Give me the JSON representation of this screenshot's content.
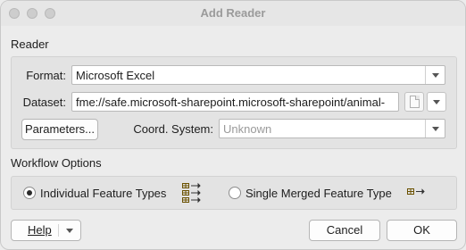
{
  "window": {
    "title": "Add Reader"
  },
  "reader": {
    "section_label": "Reader",
    "format_label": "Format:",
    "format_value": "Microsoft Excel",
    "dataset_label": "Dataset:",
    "dataset_value": "fme://safe.microsoft-sharepoint.microsoft-sharepoint/animal-",
    "parameters_button": "Parameters...",
    "coord_label": "Coord. System:",
    "coord_value": "Unknown"
  },
  "workflow": {
    "section_label": "Workflow Options",
    "individual_label": "Individual Feature Types",
    "individual_checked": true,
    "merged_label": "Single Merged Feature Type",
    "merged_checked": false,
    "individual_icon": "multiple-feature-types-icon",
    "merged_icon": "single-feature-type-icon",
    "icon_color": "#8a6a00"
  },
  "footer": {
    "help_button": "Help",
    "cancel_button": "Cancel",
    "ok_button": "OK"
  }
}
